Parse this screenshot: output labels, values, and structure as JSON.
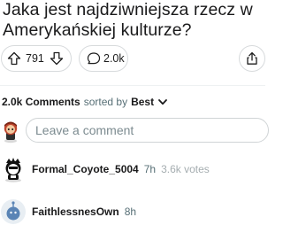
{
  "post": {
    "title": "Jaka jest najdziwniejsza rzecz w Amerykańskiej kulturze?"
  },
  "actions": {
    "upvote_icon": "arrow-up-icon",
    "score": "791",
    "downvote_icon": "arrow-down-icon",
    "comment_icon": "speech-bubble-icon",
    "comment_count": "2.0k",
    "share_icon": "share-icon"
  },
  "comments_header": {
    "count_label": "2.0k Comments",
    "sort_prefix": "sorted by",
    "sort_value": "Best"
  },
  "comment_box": {
    "placeholder": "Leave a comment"
  },
  "comments": [
    {
      "author": "Formal_Coyote_5004",
      "time": "7h",
      "votes": "3.6k votes"
    },
    {
      "author": "FaithlessnesOwn",
      "time": "8h"
    }
  ],
  "colors": {
    "text": "#1a1a1b",
    "muted": "#576f76",
    "border": "#d7dadc"
  }
}
